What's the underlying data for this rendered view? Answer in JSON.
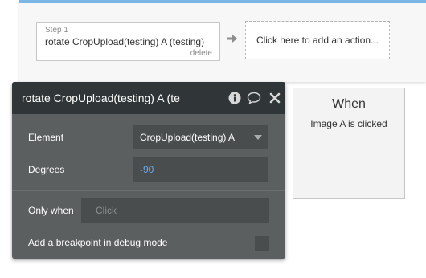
{
  "workflow": {
    "step": {
      "number_label": "Step 1",
      "title": "rotate CropUpload(testing) A (testing)",
      "delete_label": "delete"
    },
    "add_action_label": "Click here to add an action..."
  },
  "panel": {
    "title": "rotate CropUpload(testing) A (te",
    "fields": {
      "element_label": "Element",
      "element_value": "CropUpload(testing) A",
      "degrees_label": "Degrees",
      "degrees_value": "-90",
      "only_when_label": "Only when",
      "only_when_placeholder": "Click",
      "breakpoint_label": "Add a breakpoint in debug mode"
    },
    "icons": [
      "info-icon",
      "comment-icon",
      "close-icon"
    ]
  },
  "trigger": {
    "title": "When",
    "subtitle": "Image A is clicked"
  },
  "colors": {
    "panel_bg": "#5c5f60",
    "panel_header": "#303637",
    "field_bg": "#4a4d4e",
    "accent_number": "#6aa9ea",
    "canvas_top_border": "#7ab6e6"
  }
}
